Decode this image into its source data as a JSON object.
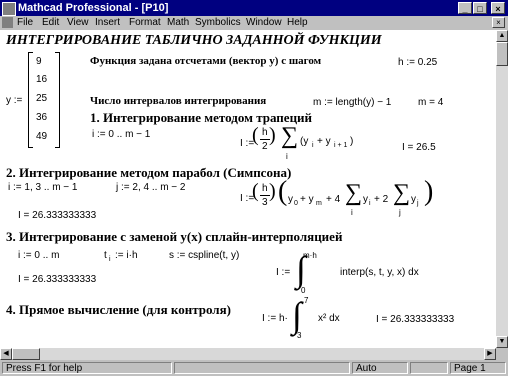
{
  "window": {
    "title": "Mathcad Professional - [P10]",
    "min_glyph": "_",
    "max_glyph": "□",
    "close_glyph": "×"
  },
  "menu": {
    "items": [
      "File",
      "Edit",
      "View",
      "Insert",
      "Format",
      "Math",
      "Symbolics",
      "Window",
      "Help"
    ],
    "doc_close_glyph": "×"
  },
  "doc": {
    "heading": "ИНТЕГРИРОВАНИЕ ТАБЛИЧНО ЗАДАННОЙ ФУНКЦИИ",
    "y_label": "y :=",
    "y_vector": [
      "9",
      "16",
      "25",
      "36",
      "49"
    ],
    "func_text": "Функция задана отсчетами (вектор y) с шагом",
    "h_def": "h := 0.25",
    "num_text": "Число интервалов интегрирования",
    "m_def": "m := length(y) − 1",
    "m_val": "m = 4",
    "sec1_title": "1. Интегрирование методом трапеций",
    "sec1_range": "i := 0 .. m − 1",
    "sec1_I": "I :=",
    "sec1_h": "h",
    "sec1_2": "2",
    "sec1_sum": "∑",
    "sec1_sub": "i",
    "sec1_terms": "(y",
    "sec1_terms2": "+ y",
    "sec1_result": "I = 26.5",
    "sec2_title": "2. Интегрирование методом парабол (Симпсона)",
    "sec2_i": "i := 1, 3 .. m − 1",
    "sec2_j": "j := 2, 4 .. m − 2",
    "sec2_I": "I :=",
    "sec2_h": "h",
    "sec2_3": "3",
    "sec2_expr1": "y",
    "sec2_expr2": "+ y",
    "sec2_expr3": "+ 4",
    "sec2_expr4": "y",
    "sec2_expr5": "+ 2",
    "sec2_expr6": "y",
    "sec2_sub_i": "i",
    "sec2_sub_j": "j",
    "sec2_result": "I = 26.333333333",
    "sec3_title": "3. Интегрирование с заменой y(x) сплайн-интерполяцией",
    "sec3_i": "i := 0 .. m",
    "sec3_t": "t",
    "sec3_t2": ":= i·h",
    "sec3_s": "s := cspline(t, y)",
    "sec3_I": "I :=",
    "sec3_upper": "m·h",
    "sec3_lower": "0",
    "sec3_integrand": "interp(s, t, y, x) dx",
    "sec3_result": "I = 26.333333333",
    "sec4_title": "4. Прямое вычисление (для контроля)",
    "sec4_I": "I := h·",
    "sec4_upper": "7",
    "sec4_lower": "3",
    "sec4_integrand": "x² dx",
    "sec4_result": "I = 26.333333333"
  },
  "status": {
    "help": "Press F1 for help",
    "auto": "Auto",
    "page": "Page 1"
  }
}
